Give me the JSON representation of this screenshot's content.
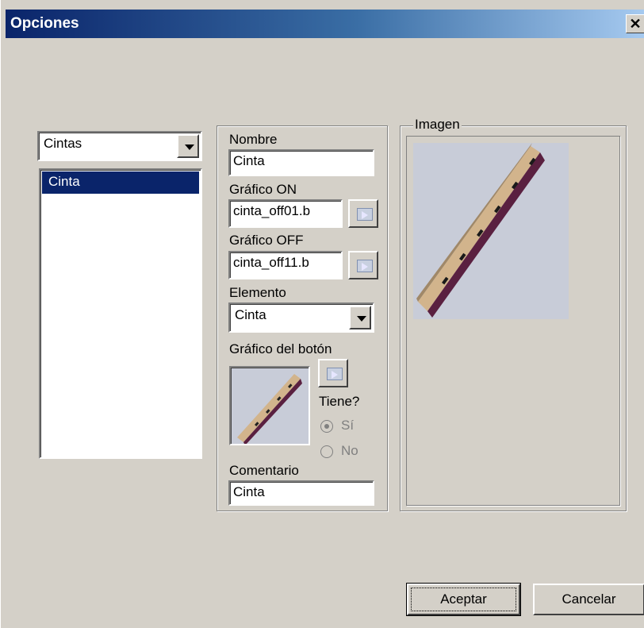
{
  "window": {
    "title": "Opciones",
    "close_glyph": "✕"
  },
  "left": {
    "category_select": "Cintas",
    "list_items": [
      "Cinta"
    ]
  },
  "form": {
    "nombre_label": "Nombre",
    "nombre_value": "Cinta",
    "grafico_on_label": "Gráfico ON",
    "grafico_on_value": "cinta_off01.b",
    "grafico_off_label": "Gráfico OFF",
    "grafico_off_value": "cinta_off11.b",
    "elemento_label": "Elemento",
    "elemento_value": "Cinta",
    "boton_label": "Gráfico del botón",
    "tiene_label": "Tiene?",
    "radio_si": "Sí",
    "radio_no": "No",
    "radio_selected": "Sí",
    "comentario_label": "Comentario",
    "comentario_value": "Cinta"
  },
  "imagen": {
    "group_label": "Imagen"
  },
  "buttons": {
    "accept": "Aceptar",
    "cancel": "Cancelar"
  },
  "colors": {
    "title_active": "#0a246a",
    "selection": "#0a246a",
    "face": "#d4d0c8"
  }
}
